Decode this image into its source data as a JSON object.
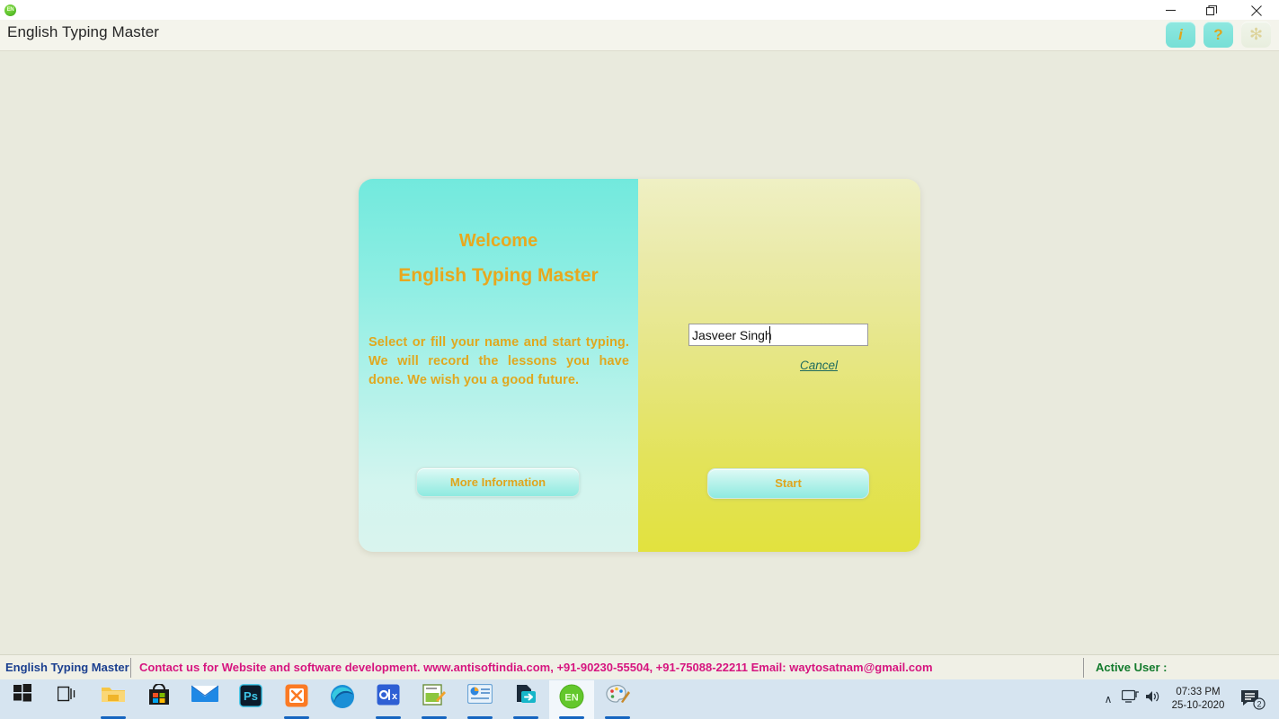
{
  "window": {
    "title": "English Typing Master",
    "app_icon_label": "EN",
    "controls": {
      "minimize": "minimize-icon",
      "restore": "restore-icon",
      "close": "close-icon"
    },
    "header_buttons": [
      {
        "name": "info-button",
        "glyph": "i"
      },
      {
        "name": "help-button",
        "glyph": "?"
      },
      {
        "name": "settings-button",
        "glyph": "✻"
      }
    ]
  },
  "card": {
    "left": {
      "welcome": "Welcome",
      "app_name": "English Typing Master",
      "blurb": "Select or fill your name and start typing. We will record the lessons you have done. We wish you a good future.",
      "more_info_label": "More Information"
    },
    "right": {
      "name_value": "Jasveer Singh",
      "name_placeholder": "",
      "cancel_label": "Cancel",
      "start_label": "Start"
    }
  },
  "statusbar": {
    "app_label": "English Typing Master",
    "contact": "Contact us for Website and software development. www.antisoftindia.com, +91-90230-55504, +91-75088-22211  Email: waytosatnam@gmail.com",
    "active_user": "Active User :"
  },
  "taskbar": {
    "items": [
      {
        "name": "start-button-icon",
        "label": "⊞",
        "active": false,
        "open": false
      },
      {
        "name": "task-view-icon",
        "label": "⌸",
        "active": false,
        "open": false
      },
      {
        "name": "file-explorer-icon",
        "label": "🗁",
        "active": false,
        "open": true
      },
      {
        "name": "microsoft-store-icon",
        "label": "🛍",
        "active": false,
        "open": false
      },
      {
        "name": "mail-icon",
        "label": "✉",
        "active": false,
        "open": false
      },
      {
        "name": "photoshop-icon",
        "label": "Ps",
        "active": false,
        "open": false
      },
      {
        "name": "xampp-icon",
        "label": "⧉",
        "active": false,
        "open": true
      },
      {
        "name": "edge-browser-icon",
        "label": "◔",
        "active": false,
        "open": false
      },
      {
        "name": "olx-icon",
        "label": "o|x",
        "active": false,
        "open": true
      },
      {
        "name": "notepad-editor-icon",
        "label": "✎",
        "active": false,
        "open": true
      },
      {
        "name": "presentation-icon",
        "label": "▤",
        "active": false,
        "open": true
      },
      {
        "name": "export-doc-icon",
        "label": "➡",
        "active": false,
        "open": true
      },
      {
        "name": "english-typing-master-icon",
        "label": "EN",
        "active": true,
        "open": true
      },
      {
        "name": "paint-palette-icon",
        "label": "🎨",
        "active": false,
        "open": true
      }
    ],
    "tray": {
      "chevron": "∧",
      "network_icon": "network-icon",
      "volume_icon": "volume-icon",
      "time": "07:33 PM",
      "date": "25-10-2020",
      "notification_count": "2"
    }
  },
  "colors": {
    "accent_gold": "#e8a81e",
    "teal": "#72e9dd",
    "yellow": "#e2e23e",
    "contact_pink": "#d6157f",
    "app_blue": "#1b3f8f",
    "active_green": "#127a2c"
  }
}
